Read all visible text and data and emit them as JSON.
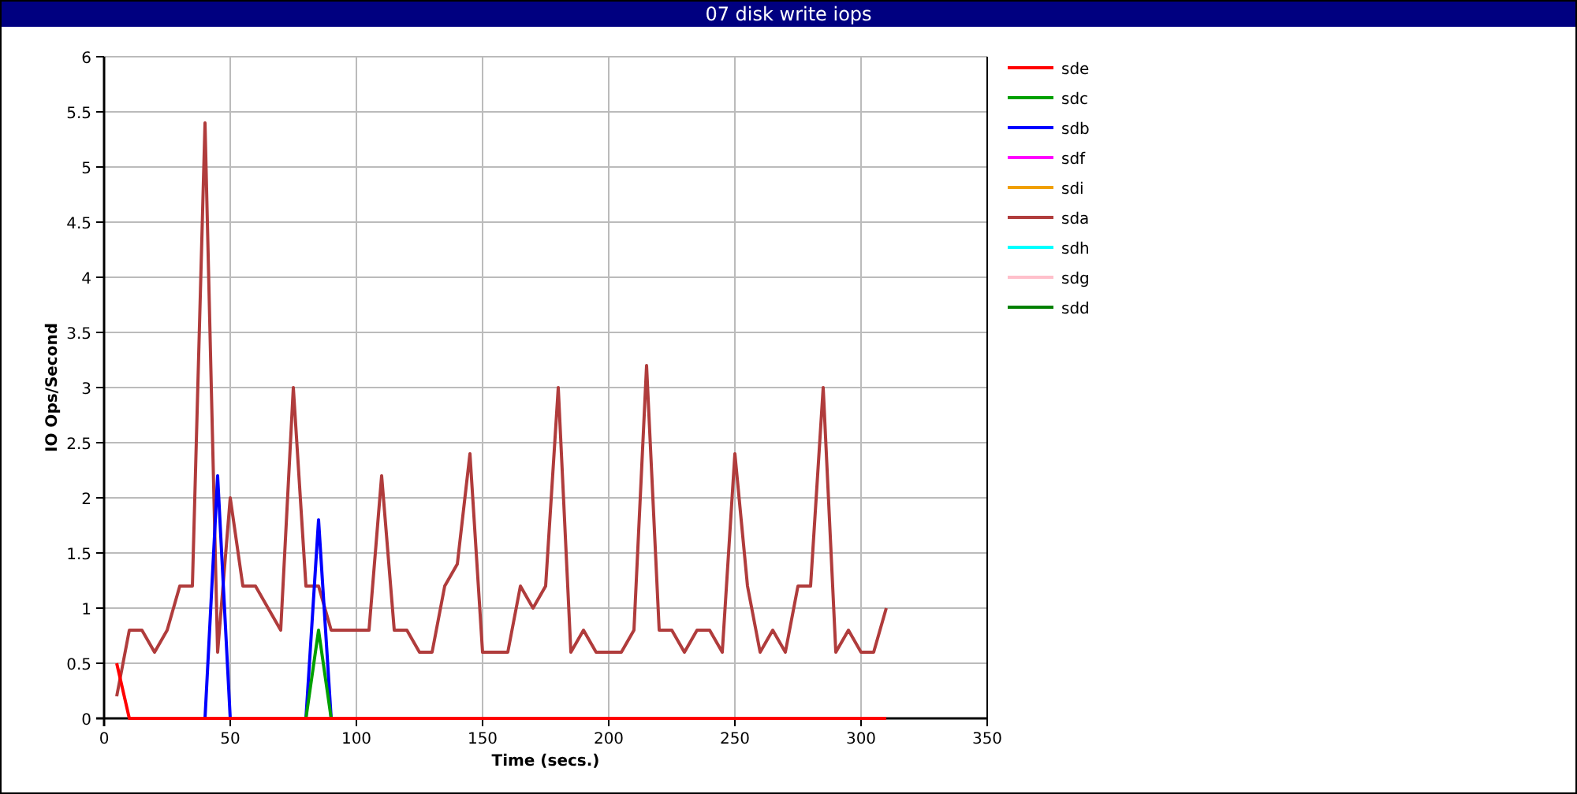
{
  "window": {
    "title": "07 disk write iops"
  },
  "chart": {
    "chart_data": {
      "type": "line",
      "xlabel": "Time (secs.)",
      "ylabel": "IO Ops/Second",
      "xlim": [
        0,
        350
      ],
      "ylim": [
        0,
        6
      ],
      "xticks": [
        0,
        50,
        100,
        150,
        200,
        250,
        300,
        350
      ],
      "yticks": [
        {
          "value": 0,
          "label": "0"
        },
        {
          "value": 0.5,
          "label": "0.5"
        },
        {
          "value": 1,
          "label": "1"
        },
        {
          "value": 1.5,
          "label": "1.5"
        },
        {
          "value": 2,
          "label": "2"
        },
        {
          "value": 2.5,
          "label": "2.5"
        },
        {
          "value": 3,
          "label": "3"
        },
        {
          "value": 3.5,
          "label": "3.5"
        },
        {
          "value": 4,
          "label": "4"
        },
        {
          "value": 4.5,
          "label": "4.5"
        },
        {
          "value": 5,
          "label": "5"
        },
        {
          "value": 5.5,
          "label": "5.5"
        },
        {
          "value": 6,
          "label": "6"
        }
      ],
      "x": [
        5,
        10,
        15,
        20,
        25,
        30,
        35,
        40,
        45,
        50,
        55,
        60,
        65,
        70,
        75,
        80,
        85,
        90,
        95,
        100,
        105,
        110,
        115,
        120,
        125,
        130,
        135,
        140,
        145,
        150,
        155,
        160,
        165,
        170,
        175,
        180,
        185,
        190,
        195,
        200,
        205,
        210,
        215,
        220,
        225,
        230,
        235,
        240,
        245,
        250,
        255,
        260,
        265,
        270,
        275,
        280,
        285,
        290,
        295,
        300,
        305,
        310
      ],
      "series": [
        {
          "name": "sde",
          "color": "#ff0000",
          "values": [
            0.5,
            0,
            0,
            0,
            0,
            0,
            0,
            0,
            0,
            0,
            0,
            0,
            0,
            0,
            0,
            0,
            0,
            0,
            0,
            0,
            0,
            0,
            0,
            0,
            0,
            0,
            0,
            0,
            0,
            0,
            0,
            0,
            0,
            0,
            0,
            0,
            0,
            0,
            0,
            0,
            0,
            0,
            0,
            0,
            0,
            0,
            0,
            0,
            0,
            0,
            0,
            0,
            0,
            0,
            0,
            0,
            0,
            0,
            0,
            0,
            0,
            0
          ]
        },
        {
          "name": "sdc",
          "color": "#00a000",
          "values": [
            null,
            null,
            null,
            null,
            null,
            null,
            null,
            null,
            null,
            null,
            null,
            null,
            null,
            null,
            null,
            0,
            0.8,
            0,
            null,
            null,
            null,
            null,
            null,
            null,
            null,
            null,
            null,
            null,
            null,
            null,
            null,
            null,
            null,
            null,
            null,
            null,
            null,
            null,
            null,
            null,
            null,
            null,
            null,
            null,
            null,
            null,
            null,
            null,
            null,
            null,
            null,
            null,
            null,
            null,
            null,
            null,
            null,
            null,
            null,
            null,
            null,
            null
          ]
        },
        {
          "name": "sdb",
          "color": "#0000ff",
          "values": [
            null,
            null,
            null,
            null,
            null,
            null,
            null,
            0,
            2.2,
            0,
            null,
            null,
            null,
            null,
            null,
            0,
            1.8,
            0,
            null,
            null,
            null,
            null,
            null,
            null,
            null,
            null,
            null,
            null,
            null,
            null,
            null,
            null,
            null,
            null,
            null,
            null,
            null,
            null,
            null,
            null,
            null,
            null,
            null,
            null,
            null,
            null,
            null,
            null,
            null,
            null,
            null,
            null,
            null,
            null,
            null,
            null,
            null,
            null,
            null,
            null,
            null,
            null
          ]
        },
        {
          "name": "sdf",
          "color": "#ff00ff",
          "values": [
            null,
            null,
            null,
            null,
            null,
            null,
            null,
            null,
            null,
            null,
            null,
            null,
            null,
            null,
            null,
            null,
            null,
            null,
            null,
            null,
            null,
            null,
            null,
            null,
            null,
            null,
            null,
            null,
            null,
            null,
            null,
            null,
            null,
            null,
            null,
            null,
            null,
            null,
            null,
            null,
            null,
            null,
            null,
            null,
            null,
            null,
            null,
            null,
            null,
            null,
            null,
            null,
            null,
            null,
            null,
            null,
            null,
            null,
            null,
            null,
            null,
            null
          ]
        },
        {
          "name": "sdi",
          "color": "#f0a000",
          "values": [
            null,
            null,
            null,
            null,
            null,
            null,
            null,
            null,
            null,
            null,
            null,
            null,
            null,
            null,
            null,
            null,
            null,
            null,
            null,
            null,
            null,
            null,
            null,
            null,
            null,
            null,
            null,
            null,
            null,
            null,
            null,
            null,
            null,
            null,
            null,
            null,
            null,
            null,
            null,
            null,
            null,
            null,
            null,
            null,
            null,
            null,
            null,
            null,
            null,
            null,
            null,
            null,
            null,
            null,
            null,
            null,
            null,
            null,
            null,
            null,
            null,
            null
          ]
        },
        {
          "name": "sda",
          "color": "#b03c3c",
          "values": [
            0.2,
            0.8,
            0.8,
            0.6,
            0.8,
            1.2,
            1.2,
            5.4,
            0.6,
            2.0,
            1.2,
            1.2,
            1.0,
            0.8,
            3.0,
            1.2,
            1.2,
            0.8,
            0.8,
            0.8,
            0.8,
            2.2,
            0.8,
            0.8,
            0.6,
            0.6,
            1.2,
            1.4,
            2.4,
            0.6,
            0.6,
            0.6,
            1.2,
            1.0,
            1.2,
            3.0,
            0.6,
            0.8,
            0.6,
            0.6,
            0.6,
            0.8,
            3.2,
            0.8,
            0.8,
            0.6,
            0.8,
            0.8,
            0.6,
            2.4,
            1.2,
            0.6,
            0.8,
            0.6,
            1.2,
            1.2,
            3.0,
            0.6,
            0.8,
            0.6,
            0.6,
            1.0
          ]
        },
        {
          "name": "sdh",
          "color": "#00ffff",
          "values": [
            null,
            null,
            null,
            null,
            null,
            null,
            null,
            null,
            null,
            null,
            null,
            null,
            null,
            null,
            null,
            null,
            null,
            null,
            null,
            null,
            null,
            null,
            null,
            null,
            null,
            null,
            null,
            null,
            null,
            null,
            null,
            null,
            null,
            null,
            null,
            null,
            null,
            null,
            null,
            null,
            null,
            null,
            null,
            null,
            null,
            null,
            null,
            null,
            null,
            null,
            null,
            null,
            null,
            null,
            null,
            null,
            null,
            null,
            null,
            null,
            null,
            null
          ]
        },
        {
          "name": "sdg",
          "color": "#ffc0cb",
          "values": [
            null,
            null,
            null,
            null,
            null,
            null,
            null,
            null,
            null,
            null,
            null,
            null,
            null,
            null,
            null,
            null,
            null,
            null,
            null,
            null,
            null,
            null,
            null,
            null,
            null,
            null,
            null,
            null,
            null,
            null,
            null,
            null,
            null,
            null,
            null,
            null,
            null,
            null,
            null,
            null,
            null,
            null,
            null,
            null,
            null,
            null,
            null,
            null,
            null,
            null,
            null,
            null,
            null,
            null,
            null,
            null,
            null,
            null,
            null,
            null,
            null,
            null
          ]
        },
        {
          "name": "sdd",
          "color": "#008000",
          "values": [
            null,
            null,
            null,
            null,
            null,
            null,
            null,
            null,
            null,
            null,
            null,
            null,
            null,
            null,
            null,
            null,
            null,
            null,
            null,
            null,
            null,
            null,
            null,
            null,
            null,
            null,
            null,
            null,
            null,
            null,
            null,
            null,
            null,
            null,
            null,
            null,
            null,
            null,
            null,
            null,
            null,
            null,
            null,
            null,
            null,
            null,
            null,
            null,
            null,
            null,
            null,
            null,
            null,
            null,
            null,
            null,
            null,
            null,
            null,
            null,
            null,
            null
          ]
        }
      ],
      "grid": true,
      "legend": "right"
    }
  }
}
